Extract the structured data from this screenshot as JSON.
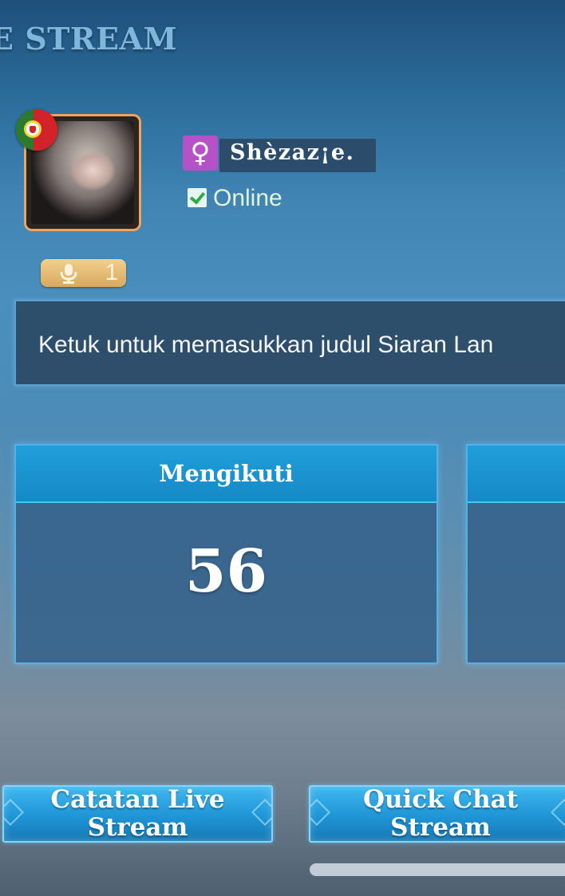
{
  "header": {
    "title": "E STREAM"
  },
  "profile": {
    "flag_icon": "portugal-flag-icon",
    "gender_icon": "female-icon",
    "gender_symbol": "♀",
    "name": "Shèzaz¡e.",
    "status": "Online",
    "mic_count": "1"
  },
  "stream_title": {
    "placeholder": "Ketuk untuk memasukkan judul Siaran Lan"
  },
  "stats": [
    {
      "label": "Mengikuti",
      "value": "56"
    }
  ],
  "buttons": {
    "history": "Catatan Live Stream",
    "quick_chat": "Quick Chat Stream"
  },
  "colors": {
    "accent": "#1f9fdb",
    "female_badge": "#b651c8",
    "avatar_border": "#e8a565",
    "mic_badge": "#d9a85c"
  }
}
